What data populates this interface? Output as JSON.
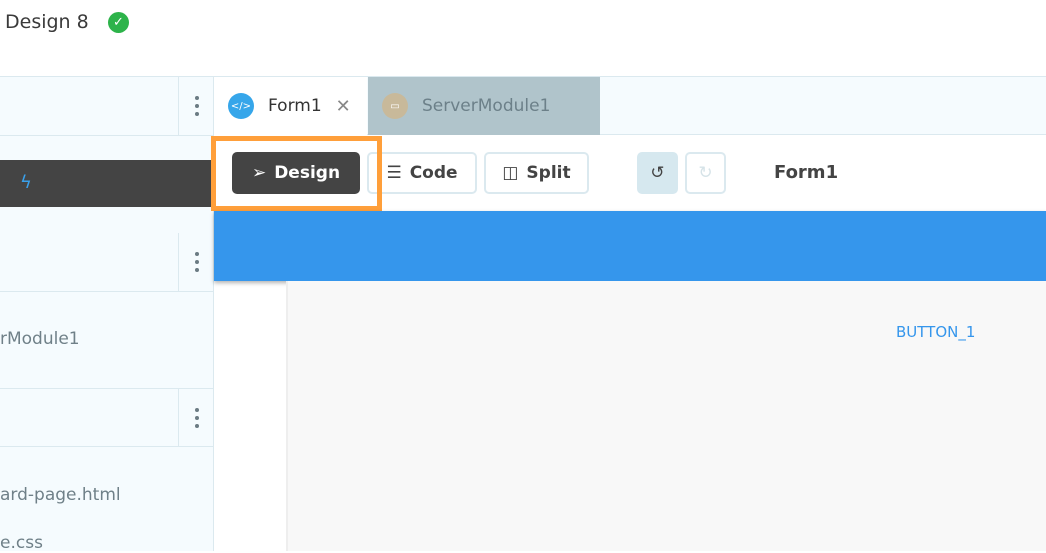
{
  "header": {
    "title": "Design 8",
    "status_icon": "check-circle-icon",
    "status_color": "#2db34a"
  },
  "sidebar": {
    "items": [
      "rModule1",
      "ard-page.html",
      "e.css"
    ]
  },
  "tabs": [
    {
      "label": "Form1",
      "icon": "code-file-icon",
      "active": true
    },
    {
      "label": "ServerModule1",
      "icon": "server-icon",
      "active": false
    }
  ],
  "toolbar": {
    "design": "Design",
    "code": "Code",
    "split": "Split",
    "form_title": "Form1"
  },
  "canvas": {
    "button_label": "BUTTON_1"
  },
  "colors": {
    "accent": "#3596ec",
    "highlight": "#ff9f3a",
    "dark": "#444444"
  }
}
